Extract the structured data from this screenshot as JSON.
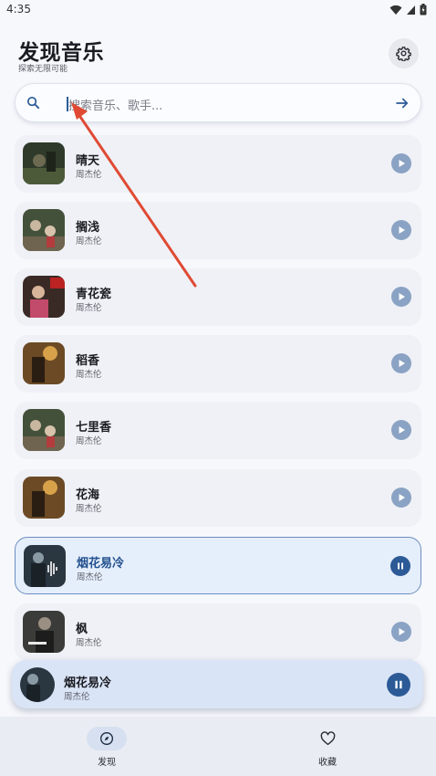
{
  "status_bar": {
    "time": "4:35"
  },
  "header": {
    "title": "发现音乐",
    "subtitle": "探索无限可能"
  },
  "search": {
    "placeholder": "搜索音乐、歌手..."
  },
  "songs": [
    {
      "title": "晴天",
      "artist": "周杰伦",
      "state": "paused"
    },
    {
      "title": "搁浅",
      "artist": "周杰伦",
      "state": "paused"
    },
    {
      "title": "青花瓷",
      "artist": "周杰伦",
      "state": "paused"
    },
    {
      "title": "稻香",
      "artist": "周杰伦",
      "state": "paused"
    },
    {
      "title": "七里香",
      "artist": "周杰伦",
      "state": "paused"
    },
    {
      "title": "花海",
      "artist": "周杰伦",
      "state": "paused"
    },
    {
      "title": "烟花易冷",
      "artist": "周杰伦",
      "state": "playing"
    },
    {
      "title": "枫",
      "artist": "周杰伦",
      "state": "paused"
    }
  ],
  "now_playing": {
    "title": "烟花易冷",
    "artist": "周杰伦"
  },
  "bottom_nav": [
    {
      "label": "发现",
      "icon": "compass-icon",
      "active": true
    },
    {
      "label": "收藏",
      "icon": "heart-icon",
      "active": false
    }
  ],
  "colors": {
    "accent": "#2c5a96",
    "play_inactive": "#8aa3c4",
    "card_bg": "#eff1f6",
    "active_card_bg": "#e5eefb",
    "annotation_arrow": "#e04a34"
  }
}
